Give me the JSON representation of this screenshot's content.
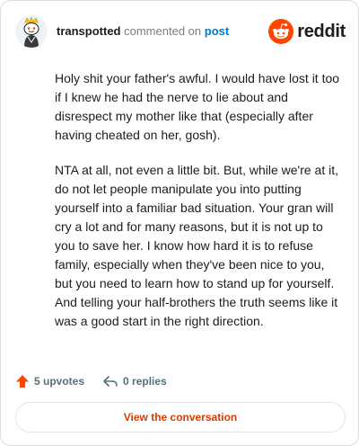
{
  "author": {
    "username": "transpotted",
    "action_text": "commented on",
    "target_link": "post",
    "avatar_icon": "snoo-avatar-icon"
  },
  "brand": {
    "name": "reddit",
    "logo_icon": "reddit-snoo-logo-icon",
    "accent_color": "#ff4500"
  },
  "comment": {
    "paragraphs": [
      "Holy shit your father's awful. I would have lost it too if I knew he had the nerve to lie about and disrespect my mother like that (especially after having cheated on her, gosh).",
      "NTA at all, not even a little bit. But, while we're at it, do not let people manipulate you into putting yourself into a familiar bad situation. Your gran will cry a lot and for many reasons, but it is not up to you to save her. I know how hard it is to refuse family, especially when they've been nice to you, but you need to learn how to stand up for yourself. And telling your half-brothers the truth seems like it was a good start in the right direction."
    ]
  },
  "actions": {
    "upvotes": "5 upvotes",
    "replies": "0 replies",
    "upvote_icon": "upvote-arrow-icon",
    "reply_icon": "reply-arrow-icon"
  },
  "footer": {
    "view_button_label": "View the conversation",
    "link_color": "#d93a00"
  }
}
